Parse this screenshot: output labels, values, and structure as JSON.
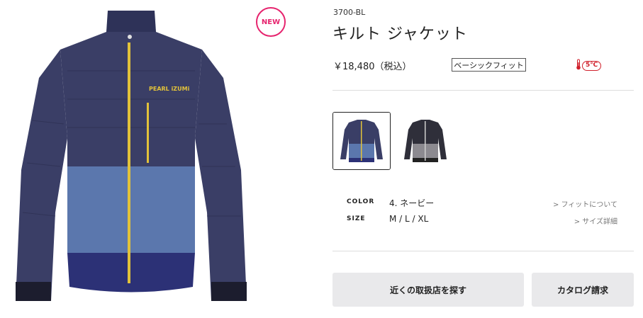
{
  "product": {
    "badge": "NEW",
    "sku": "3700-BL",
    "title": "キルト ジャケット",
    "price": "￥18,480（税込）",
    "fit": "ベーシックフィット",
    "temperature": "5℃",
    "brand_print": "PEARL iZUMi"
  },
  "colors": {
    "accent": "#e6246e",
    "jacket_navy": "#3a3e66",
    "jacket_blue": "#5b77ad",
    "zipper": "#e2c23a",
    "temp_red": "#d0202b"
  },
  "variants": [
    {
      "name": "navy",
      "selected": true
    },
    {
      "name": "gray",
      "selected": false
    }
  ],
  "specs": {
    "color_label": "COLOR",
    "color_value": "4. ネービー",
    "color_link": "> フィットについて",
    "size_label": "SIZE",
    "size_value": "M / L / XL",
    "size_link": "> サイズ詳細"
  },
  "actions": {
    "store_button": "近くの取扱店を探す",
    "catalog_button": "カタログ請求"
  }
}
